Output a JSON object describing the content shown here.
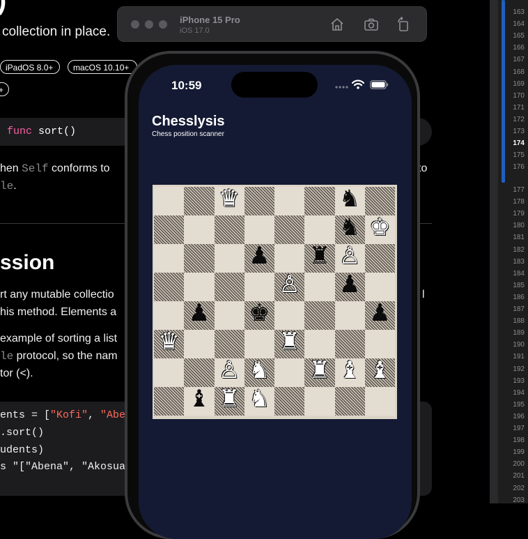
{
  "doc": {
    "paren": ")",
    "summary": "collection in place.",
    "chips": [
      "iPadOS 8.0+",
      "macOS 10.10+"
    ],
    "chip_overflow": "+",
    "decl_keyword": "func",
    "decl_name": "sort()",
    "avail_pre": "hen ",
    "avail_code": "Self",
    "avail_post": " conforms to",
    "avail_tail": "to",
    "avail_code2": "le",
    "avail_end": ".",
    "heading": "ssion",
    "para1_l1": "rt any mutable collectio",
    "para1_l2": "his method. Elements a",
    "para1_tail": "l",
    "para2_l1": "example of sorting a list",
    "para2_l2_code": "le",
    "para2_l2": " protocol, so the nam",
    "para2_l3": "tor (<).",
    "code_l1_a": "ents = [",
    "code_l1_s1": "\"Kofi\"",
    "code_l1_b": ", ",
    "code_l1_s2": "\"Abe",
    "code_l2": ".sort()",
    "code_l3": "udents)",
    "code_l4": "s \"[\"Abena\", \"Akosua"
  },
  "gutter": {
    "lines": [
      "163",
      "164",
      "165",
      "166",
      "167",
      "168",
      "169",
      "170",
      "171",
      "172",
      "173",
      "174",
      "175",
      "176",
      "177",
      "178",
      "179",
      "180",
      "181",
      "182",
      "183",
      "184",
      "185",
      "186",
      "187",
      "188",
      "189",
      "190",
      "191",
      "192",
      "193",
      "194",
      "195",
      "196",
      "197",
      "198",
      "199",
      "200",
      "201",
      "202",
      "203"
    ],
    "current": "174"
  },
  "simulator": {
    "device": "iPhone 15 Pro",
    "os": "iOS 17.0",
    "buttons": [
      "home-icon",
      "screenshot-icon",
      "rotate-icon"
    ]
  },
  "app": {
    "time": "10:59",
    "title": "Chesslysis",
    "subtitle": "Chess position scanner",
    "board": {
      "pieces": [
        {
          "square": "c8",
          "glyph": "♛",
          "color": "white"
        },
        {
          "square": "g8",
          "glyph": "♞",
          "color": "black"
        },
        {
          "square": "g7",
          "glyph": "♞",
          "color": "black"
        },
        {
          "square": "h7",
          "glyph": "♚",
          "color": "white"
        },
        {
          "square": "d6",
          "glyph": "♟",
          "color": "black"
        },
        {
          "square": "f6",
          "glyph": "♜",
          "color": "black"
        },
        {
          "square": "g6",
          "glyph": "♙",
          "color": "white"
        },
        {
          "square": "e5",
          "glyph": "♙",
          "color": "white"
        },
        {
          "square": "g5",
          "glyph": "♟",
          "color": "black"
        },
        {
          "square": "b4",
          "glyph": "♟",
          "color": "black"
        },
        {
          "square": "d4",
          "glyph": "♚",
          "color": "black"
        },
        {
          "square": "h4",
          "glyph": "♟",
          "color": "black"
        },
        {
          "square": "a3",
          "glyph": "♛",
          "color": "white"
        },
        {
          "square": "e3",
          "glyph": "♜",
          "color": "white"
        },
        {
          "square": "c2",
          "glyph": "♙",
          "color": "white"
        },
        {
          "square": "d2",
          "glyph": "♞",
          "color": "white"
        },
        {
          "square": "f2",
          "glyph": "♜",
          "color": "white"
        },
        {
          "square": "g2",
          "glyph": "♝",
          "color": "white"
        },
        {
          "square": "h2",
          "glyph": "♝",
          "color": "white"
        },
        {
          "square": "b1",
          "glyph": "♝",
          "color": "black"
        },
        {
          "square": "c1",
          "glyph": "♜",
          "color": "white"
        },
        {
          "square": "d1",
          "glyph": "♞",
          "color": "white"
        }
      ]
    }
  },
  "colors": {
    "screen_bg": "#141a33",
    "keyword": "#fc5fa3",
    "string": "#fc6a5d",
    "accent": "#1f5fbf"
  }
}
